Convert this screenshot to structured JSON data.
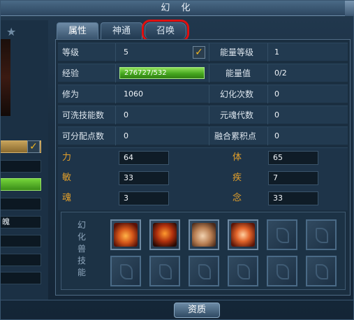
{
  "window": {
    "title": "幻 化"
  },
  "tabs": [
    {
      "label": "属性",
      "active": true
    },
    {
      "label": "神通",
      "active": false
    },
    {
      "label": "召唤",
      "active": false,
      "highlighted": true
    }
  ],
  "left_panel": {
    "name_fragment": "魄",
    "exp_fill": 1.0
  },
  "stats_rows": [
    {
      "label": "等级",
      "value": "5",
      "checked": true,
      "label2": "能量等级",
      "value2": "1"
    },
    {
      "label": "经验",
      "value": "276727/532",
      "bar": true,
      "bar_fill": 1.0,
      "label2": "能量值",
      "value2": "0/2"
    },
    {
      "label": "修为",
      "value": "1060",
      "label2": "幻化次数",
      "value2": "0"
    },
    {
      "label": "可洗技能数",
      "value": "0",
      "label2": "元魂代数",
      "value2": "0"
    },
    {
      "label": "可分配点数",
      "value": "0",
      "label2": "融合累积点",
      "value2": "0"
    }
  ],
  "attributes": [
    {
      "label": "力",
      "value": "64",
      "label2": "体",
      "value2": "65"
    },
    {
      "label": "敏",
      "value": "33",
      "label2": "疾",
      "value2": "7"
    },
    {
      "label": "魂",
      "value": "3",
      "label2": "念",
      "value2": "33"
    }
  ],
  "skills": {
    "label": "幻化兽技能",
    "slots": [
      {
        "filled": true,
        "icon": "flame-beast-skill-icon"
      },
      {
        "filled": true,
        "icon": "demon-skill-icon"
      },
      {
        "filled": true,
        "icon": "claw-skill-icon"
      },
      {
        "filled": true,
        "icon": "fire-orb-skill-icon"
      },
      {
        "filled": false
      },
      {
        "filled": false
      },
      {
        "filled": false
      },
      {
        "filled": false
      },
      {
        "filled": false
      },
      {
        "filled": false
      },
      {
        "filled": false
      },
      {
        "filled": false
      }
    ]
  },
  "footer": {
    "button_label": "资质"
  },
  "colors": {
    "attr_label": "#e4a02a",
    "exp_bar": "#46a81f",
    "highlight": "#e01010"
  }
}
